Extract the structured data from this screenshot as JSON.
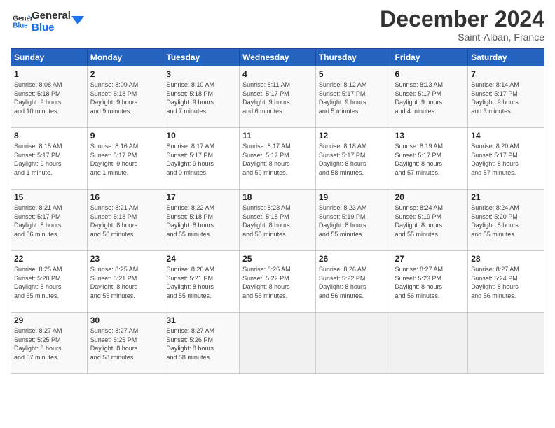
{
  "logo": {
    "line1": "General",
    "line2": "Blue"
  },
  "header": {
    "title": "December 2024",
    "subtitle": "Saint-Alban, France"
  },
  "weekdays": [
    "Sunday",
    "Monday",
    "Tuesday",
    "Wednesday",
    "Thursday",
    "Friday",
    "Saturday"
  ],
  "weeks": [
    [
      {
        "day": "1",
        "info": "Sunrise: 8:08 AM\nSunset: 5:18 PM\nDaylight: 9 hours\nand 10 minutes."
      },
      {
        "day": "2",
        "info": "Sunrise: 8:09 AM\nSunset: 5:18 PM\nDaylight: 9 hours\nand 9 minutes."
      },
      {
        "day": "3",
        "info": "Sunrise: 8:10 AM\nSunset: 5:18 PM\nDaylight: 9 hours\nand 7 minutes."
      },
      {
        "day": "4",
        "info": "Sunrise: 8:11 AM\nSunset: 5:17 PM\nDaylight: 9 hours\nand 6 minutes."
      },
      {
        "day": "5",
        "info": "Sunrise: 8:12 AM\nSunset: 5:17 PM\nDaylight: 9 hours\nand 5 minutes."
      },
      {
        "day": "6",
        "info": "Sunrise: 8:13 AM\nSunset: 5:17 PM\nDaylight: 9 hours\nand 4 minutes."
      },
      {
        "day": "7",
        "info": "Sunrise: 8:14 AM\nSunset: 5:17 PM\nDaylight: 9 hours\nand 3 minutes."
      }
    ],
    [
      {
        "day": "8",
        "info": "Sunrise: 8:15 AM\nSunset: 5:17 PM\nDaylight: 9 hours\nand 1 minute."
      },
      {
        "day": "9",
        "info": "Sunrise: 8:16 AM\nSunset: 5:17 PM\nDaylight: 9 hours\nand 1 minute."
      },
      {
        "day": "10",
        "info": "Sunrise: 8:17 AM\nSunset: 5:17 PM\nDaylight: 9 hours\nand 0 minutes."
      },
      {
        "day": "11",
        "info": "Sunrise: 8:17 AM\nSunset: 5:17 PM\nDaylight: 8 hours\nand 59 minutes."
      },
      {
        "day": "12",
        "info": "Sunrise: 8:18 AM\nSunset: 5:17 PM\nDaylight: 8 hours\nand 58 minutes."
      },
      {
        "day": "13",
        "info": "Sunrise: 8:19 AM\nSunset: 5:17 PM\nDaylight: 8 hours\nand 57 minutes."
      },
      {
        "day": "14",
        "info": "Sunrise: 8:20 AM\nSunset: 5:17 PM\nDaylight: 8 hours\nand 57 minutes."
      }
    ],
    [
      {
        "day": "15",
        "info": "Sunrise: 8:21 AM\nSunset: 5:17 PM\nDaylight: 8 hours\nand 56 minutes."
      },
      {
        "day": "16",
        "info": "Sunrise: 8:21 AM\nSunset: 5:18 PM\nDaylight: 8 hours\nand 56 minutes."
      },
      {
        "day": "17",
        "info": "Sunrise: 8:22 AM\nSunset: 5:18 PM\nDaylight: 8 hours\nand 55 minutes."
      },
      {
        "day": "18",
        "info": "Sunrise: 8:23 AM\nSunset: 5:18 PM\nDaylight: 8 hours\nand 55 minutes."
      },
      {
        "day": "19",
        "info": "Sunrise: 8:23 AM\nSunset: 5:19 PM\nDaylight: 8 hours\nand 55 minutes."
      },
      {
        "day": "20",
        "info": "Sunrise: 8:24 AM\nSunset: 5:19 PM\nDaylight: 8 hours\nand 55 minutes."
      },
      {
        "day": "21",
        "info": "Sunrise: 8:24 AM\nSunset: 5:20 PM\nDaylight: 8 hours\nand 55 minutes."
      }
    ],
    [
      {
        "day": "22",
        "info": "Sunrise: 8:25 AM\nSunset: 5:20 PM\nDaylight: 8 hours\nand 55 minutes."
      },
      {
        "day": "23",
        "info": "Sunrise: 8:25 AM\nSunset: 5:21 PM\nDaylight: 8 hours\nand 55 minutes."
      },
      {
        "day": "24",
        "info": "Sunrise: 8:26 AM\nSunset: 5:21 PM\nDaylight: 8 hours\nand 55 minutes."
      },
      {
        "day": "25",
        "info": "Sunrise: 8:26 AM\nSunset: 5:22 PM\nDaylight: 8 hours\nand 55 minutes."
      },
      {
        "day": "26",
        "info": "Sunrise: 8:26 AM\nSunset: 5:22 PM\nDaylight: 8 hours\nand 56 minutes."
      },
      {
        "day": "27",
        "info": "Sunrise: 8:27 AM\nSunset: 5:23 PM\nDaylight: 8 hours\nand 56 minutes."
      },
      {
        "day": "28",
        "info": "Sunrise: 8:27 AM\nSunset: 5:24 PM\nDaylight: 8 hours\nand 56 minutes."
      }
    ],
    [
      {
        "day": "29",
        "info": "Sunrise: 8:27 AM\nSunset: 5:25 PM\nDaylight: 8 hours\nand 57 minutes."
      },
      {
        "day": "30",
        "info": "Sunrise: 8:27 AM\nSunset: 5:25 PM\nDaylight: 8 hours\nand 58 minutes."
      },
      {
        "day": "31",
        "info": "Sunrise: 8:27 AM\nSunset: 5:26 PM\nDaylight: 8 hours\nand 58 minutes."
      },
      {
        "day": "",
        "info": ""
      },
      {
        "day": "",
        "info": ""
      },
      {
        "day": "",
        "info": ""
      },
      {
        "day": "",
        "info": ""
      }
    ]
  ]
}
